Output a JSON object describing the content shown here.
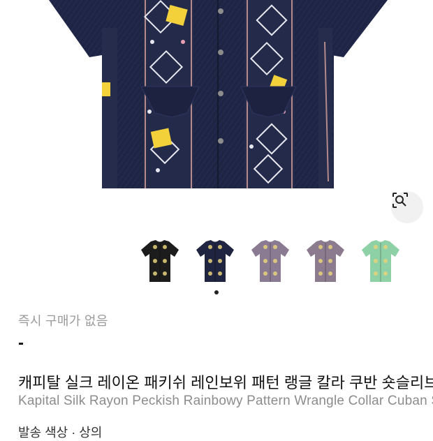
{
  "product": {
    "image_alt": "Kapital Silk Rayon Peckish Rainbowy Pattern Wrangle Collar Cuban Shirt",
    "status": "즉시 구매가 없음",
    "price": "-",
    "title_ko": "캐피탈 실크 레이온 패키쉬 레인보위 패턴 랭글 칼라 쿠반 숏슬리브",
    "title_en": "Kapital Silk Rayon Peckish Rainbowy Pattern Wrangle Collar Cuban Shirt",
    "size_line": "발송 색상 · 상의"
  },
  "lens": {
    "icon": "lens-search-icon"
  },
  "thumbnails": [
    {
      "name": "black",
      "color": "#1c1c1c"
    },
    {
      "name": "navy",
      "color": "#1f2540"
    },
    {
      "name": "lavender",
      "color": "#8a7b93"
    },
    {
      "name": "mauve",
      "color": "#8c7a8e"
    },
    {
      "name": "mint",
      "color": "#8fd1a6"
    }
  ],
  "carousel": {
    "active_index": 1,
    "total": 1
  }
}
